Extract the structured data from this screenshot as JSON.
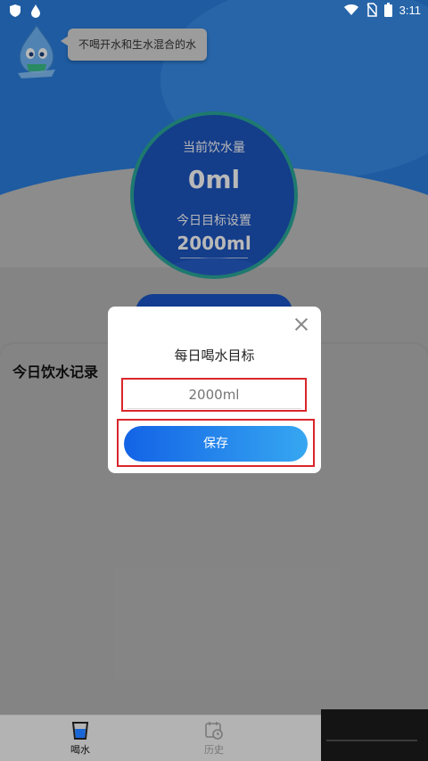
{
  "status_bar": {
    "time": "3:11"
  },
  "banner": {
    "tip_text": "不喝开水和生水混合的水"
  },
  "intake": {
    "current_label": "当前饮水量",
    "current_value": "0ml",
    "goal_label": "今日目标设置",
    "goal_value": "2000ml"
  },
  "records": {
    "title": "今日饮水记录"
  },
  "dialog": {
    "title": "每日喝水目标",
    "input_value": "",
    "input_placeholder": "2000ml",
    "save_label": "保存"
  },
  "nav": {
    "items": [
      {
        "label": "喝水",
        "icon": "cup-icon",
        "active": true
      },
      {
        "label": "历史",
        "icon": "calendar-clock-icon",
        "active": false
      }
    ]
  },
  "colors": {
    "primary_blue": "#1c55c0",
    "ring": "#2aa89a",
    "highlight_red": "#d9262b"
  }
}
